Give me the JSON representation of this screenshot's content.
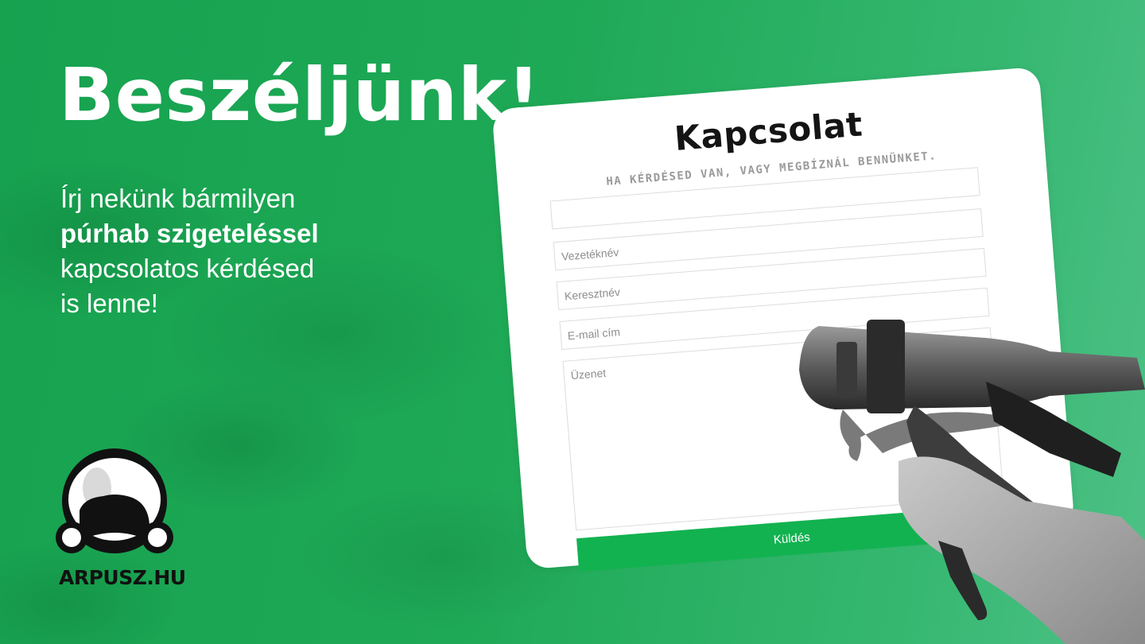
{
  "headline": "Beszéljünk!",
  "intro": {
    "line1": "Írj nekünk bármilyen",
    "line2_bold": "púrhab szigeteléssel",
    "line3": "kapcsolatos kérdésed",
    "line4": "is lenne!"
  },
  "form": {
    "title": "Kapcsolat",
    "subtitle": "HA KÉRDÉSED VAN, VAGY MEGBÍZNÁL BENNÜNKET.",
    "fields": [
      {
        "placeholder": ""
      },
      {
        "placeholder": "Vezetéknév"
      },
      {
        "placeholder": "Keresztnév"
      },
      {
        "placeholder": "E-mail cím"
      }
    ],
    "message_placeholder": "Üzenet",
    "submit_label": "Küldés"
  },
  "logo": {
    "text": "ARPUSZ.HU"
  },
  "colors": {
    "brand_green": "#12b250",
    "background_green": "#1ea956"
  },
  "icons": {
    "logo": "helmet-mask-icon",
    "illustration": "foam-gun-icon"
  }
}
